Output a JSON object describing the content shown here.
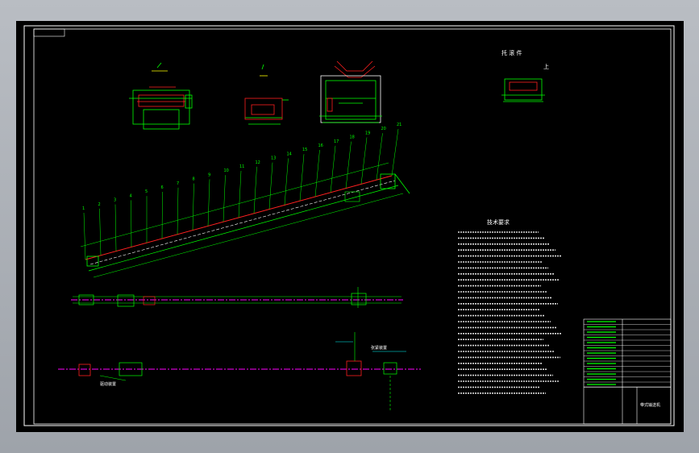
{
  "drawing": {
    "notes_title": "技术要求",
    "top_right_caption_line1": "托   滚   件",
    "top_right_caption_line2": "上",
    "lower_label_left": "驱动装置",
    "lower_label_mid": "张紧装置",
    "title_block_name": "带式输送机",
    "balloon_numbers": [
      "1",
      "2",
      "3",
      "4",
      "5",
      "6",
      "7",
      "8",
      "9",
      "10",
      "11",
      "12",
      "13",
      "14",
      "15",
      "16",
      "17",
      "18",
      "19",
      "20",
      "21"
    ]
  },
  "colors": {
    "sheet": "#000000",
    "frame": "#ffffff",
    "geometry": "#00ff00",
    "detail": "#ff2020",
    "centerline": "#ff00ff",
    "annotation": "#00ffff",
    "highlight": "#ffff00"
  }
}
